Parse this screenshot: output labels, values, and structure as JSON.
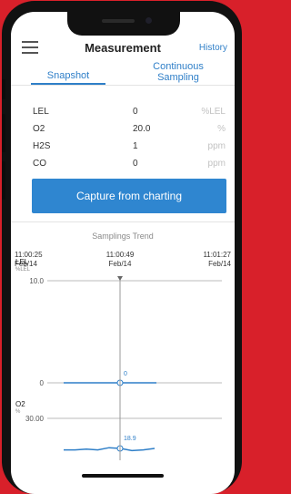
{
  "header": {
    "title": "Measurement",
    "right_link": "History"
  },
  "tabs": {
    "snapshot": "Snapshot",
    "continuous_line1": "Continuous",
    "continuous_line2": "Sampling",
    "active": "Snapshot"
  },
  "readings": [
    {
      "gas": "LEL",
      "value": "0",
      "unit": "%LEL"
    },
    {
      "gas": "O2",
      "value": "20.0",
      "unit": "%"
    },
    {
      "gas": "H2S",
      "value": "1",
      "unit": "ppm"
    },
    {
      "gas": "CO",
      "value": "0",
      "unit": "ppm"
    }
  ],
  "action_button": "Capture from charting",
  "trend": {
    "title": "Samplings Trend",
    "times": [
      {
        "time": "11:00:25",
        "date": "Feb/14"
      },
      {
        "time": "11:00:49",
        "date": "Feb/14"
      },
      {
        "time": "11:01:27",
        "date": "Feb/14"
      }
    ]
  },
  "chart_data": [
    {
      "type": "line",
      "series_label": "LEL",
      "unit": "%LEL",
      "y_ticks": [
        "10.0",
        "0"
      ],
      "ylim": [
        0,
        10
      ],
      "cursor_value": "0",
      "values": [
        0,
        0,
        0,
        0,
        0,
        0,
        0,
        0
      ]
    },
    {
      "type": "line",
      "series_label": "O2",
      "unit": "%",
      "y_ticks": [
        "30.00"
      ],
      "cursor_value": "18.9",
      "values": [
        18.7,
        18.7,
        18.8,
        18.7,
        19.0,
        18.9,
        18.6,
        18.7,
        18.9
      ]
    }
  ],
  "colors": {
    "accent": "#2f7fc8",
    "button": "#2f86d0",
    "background": "#d8202a"
  }
}
